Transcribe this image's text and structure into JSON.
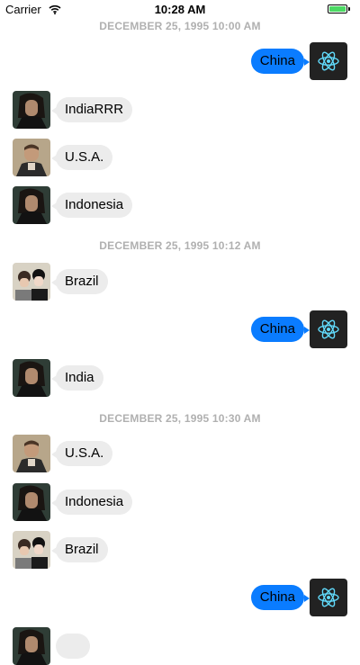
{
  "status_bar": {
    "carrier": "Carrier",
    "time": "10:28 AM"
  },
  "messages": [
    {
      "date": "DECEMBER 25, 1995 10:00 AM"
    },
    {
      "side": "outgoing",
      "text": "China",
      "avatar": "react-logo-icon"
    },
    {
      "side": "incoming",
      "text": "IndiaRRR",
      "avatar": "man-long-hair-photo"
    },
    {
      "side": "incoming",
      "text": "U.S.A.",
      "avatar": "man-jacket-photo"
    },
    {
      "side": "incoming",
      "text": "Indonesia",
      "avatar": "man-long-hair-photo"
    },
    {
      "date": "DECEMBER 25, 1995 10:12 AM"
    },
    {
      "side": "incoming",
      "text": "Brazil",
      "avatar": "couple-photo"
    },
    {
      "side": "outgoing",
      "text": "China",
      "avatar": "react-logo-icon"
    },
    {
      "side": "incoming",
      "text": "India",
      "avatar": "man-long-hair-photo"
    },
    {
      "date": "DECEMBER 25, 1995 10:30 AM"
    },
    {
      "side": "incoming",
      "text": "U.S.A.",
      "avatar": "man-jacket-photo"
    },
    {
      "side": "incoming",
      "text": "Indonesia",
      "avatar": "man-long-hair-photo"
    },
    {
      "side": "incoming",
      "text": "Brazil",
      "avatar": "couple-photo"
    },
    {
      "side": "outgoing",
      "text": "China",
      "avatar": "react-logo-icon"
    },
    {
      "side": "incoming",
      "text": "",
      "avatar": "man-long-hair-photo"
    }
  ],
  "colors": {
    "outgoing_bubble": "#0a7cff",
    "incoming_bubble": "#ececec",
    "date_label": "#b0b0b0",
    "battery": "#4cd964",
    "react_logo": "#61dafb"
  }
}
